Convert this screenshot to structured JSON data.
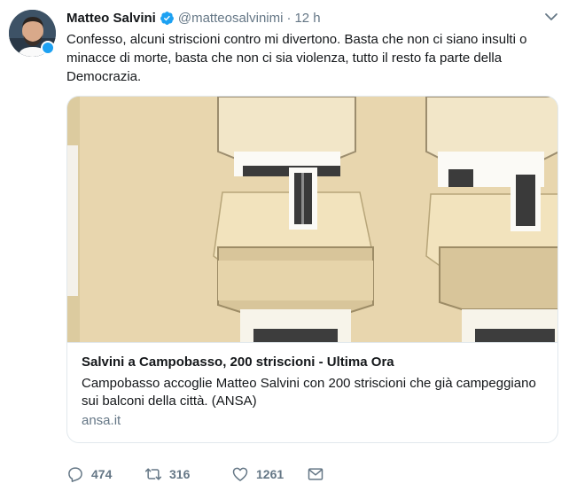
{
  "author": {
    "name": "Matteo Salvini",
    "handle": "@matteosalvinimi",
    "separator": "·",
    "time": "12 h"
  },
  "tweet": {
    "text": "Confesso, alcuni striscioni contro mi divertono. Basta che non ci siano insulti o minacce di morte, basta che non ci sia violenza, tutto il resto fa parte della Democrazia."
  },
  "card": {
    "title": "Salvini a Campobasso, 200 striscioni - Ultima Ora",
    "description": "Campobasso accoglie Matteo Salvini con 200 striscioni che già campeggiano sui balconi della città. (ANSA)",
    "domain": "ansa.it"
  },
  "actions": {
    "replies": "474",
    "retweets": "316",
    "likes": "1261"
  },
  "icons": {
    "verified": "verified-badge-icon",
    "more": "chevron-down-icon",
    "reply": "reply-icon",
    "retweet": "retweet-icon",
    "like": "heart-icon",
    "dm": "envelope-icon"
  },
  "colors": {
    "accent": "#1da1f2",
    "text": "#14171a",
    "muted": "#657786",
    "border": "#e1e8ed"
  }
}
